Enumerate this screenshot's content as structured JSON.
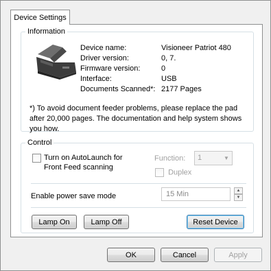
{
  "tabs": [
    {
      "label": "Device Settings",
      "active": true
    }
  ],
  "information": {
    "title": "Information",
    "rows": [
      {
        "label": "Device name:",
        "value": "Visioneer Patriot 480"
      },
      {
        "label": "Driver version:",
        "value": "0, 7."
      },
      {
        "label": "Firmware version:",
        "value": "0"
      },
      {
        "label": "Interface:",
        "value": "USB"
      },
      {
        "label": "Documents Scanned*:",
        "value": "2177 Pages"
      }
    ],
    "note": "*) To avoid document feeder problems, please replace the pad after 20,000 pages. The documentation and help system shows you how."
  },
  "control": {
    "title": "Control",
    "autolaunch_label": "Turn on AutoLaunch for Front Feed scanning",
    "autolaunch_checked": false,
    "function_label": "Function:",
    "function_value": "1",
    "duplex_label": "Duplex",
    "power_save_label": "Enable power save mode",
    "power_save_value": "15 Min",
    "lamp_on_label": "Lamp On",
    "lamp_off_label": "Lamp Off",
    "reset_label": "Reset Device"
  },
  "footer": {
    "ok_label": "OK",
    "cancel_label": "Cancel",
    "apply_label": "Apply"
  },
  "icons": {
    "scanner": "scanner-icon",
    "dropdown": "chevron-down-icon",
    "spin_up": "spin-up-icon",
    "spin_down": "spin-down-icon"
  }
}
